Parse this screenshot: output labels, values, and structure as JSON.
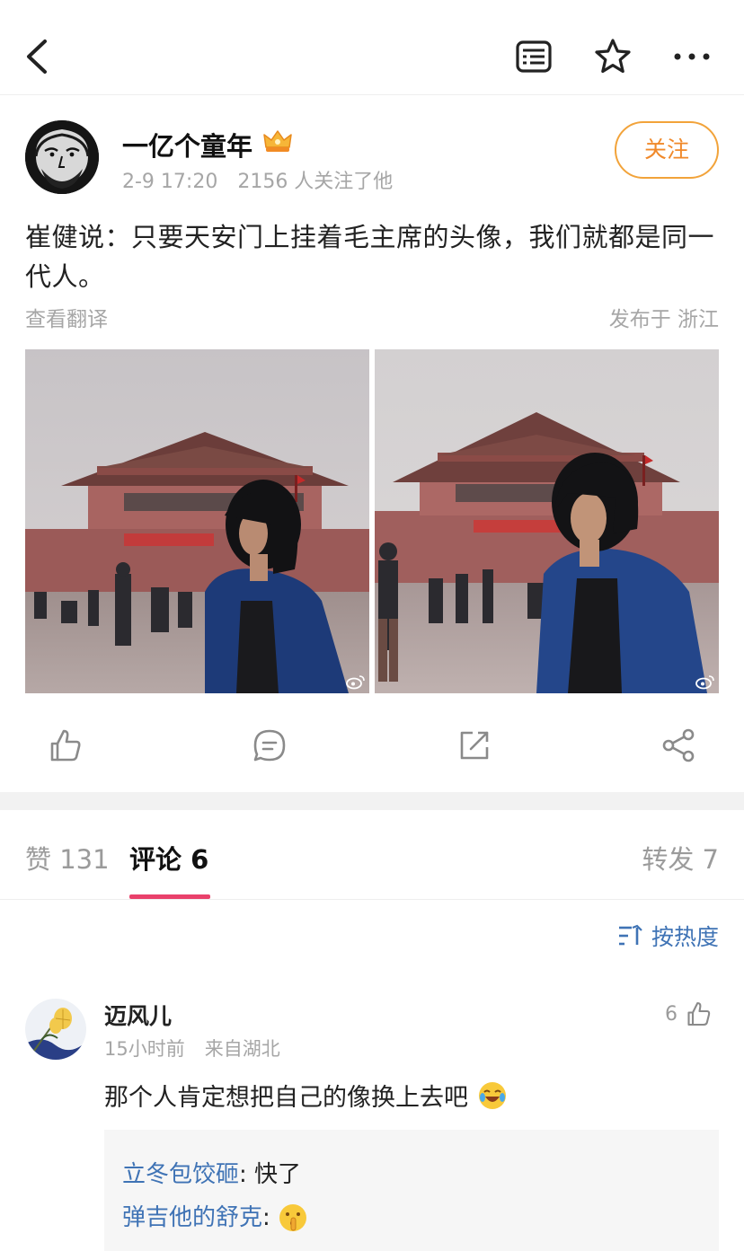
{
  "topbar": {
    "back_icon": "chevron-left-icon",
    "reader_icon": "reader-mode-icon",
    "favorite_icon": "star-icon",
    "more_icon": "more-dots-icon"
  },
  "author": {
    "name": "一亿个童年",
    "badge_icon": "crown-vip-icon",
    "time": "2-9 17:20",
    "followers": "2156 人关注了他",
    "follow_label": "关注"
  },
  "post": {
    "text": "崔健说：只要天安门上挂着毛主席的头像，我们就都是同一代人。",
    "translate_label": "查看翻译",
    "location": "发布于 浙江",
    "images": [
      "photo-1",
      "photo-2"
    ]
  },
  "actions": {
    "like_icon": "thumbs-up-icon",
    "comment_icon": "comment-icon",
    "repost_icon": "repost-icon",
    "share_icon": "share-icon"
  },
  "tabs": {
    "like": "赞 131",
    "comment": "评论 6",
    "repost": "转发 7"
  },
  "sort": {
    "label": "按热度",
    "icon": "sort-icon"
  },
  "comments": [
    {
      "name": "迈风儿",
      "time": "15小时前",
      "location": "来自湖北",
      "likes": "6",
      "text": "那个人肯定想把自己的像换上去吧",
      "emoji": "laughing-crying-emoji",
      "replies": [
        {
          "name": "立冬包饺砸",
          "text": ": 快了"
        },
        {
          "name": "弹吉他的舒克",
          "text": ":",
          "emoji": "shush-emoji"
        }
      ]
    }
  ],
  "colors": {
    "accent_orange": "#f0892a",
    "link_blue": "#3f73b5",
    "tab_indicator": "#e9416b"
  }
}
